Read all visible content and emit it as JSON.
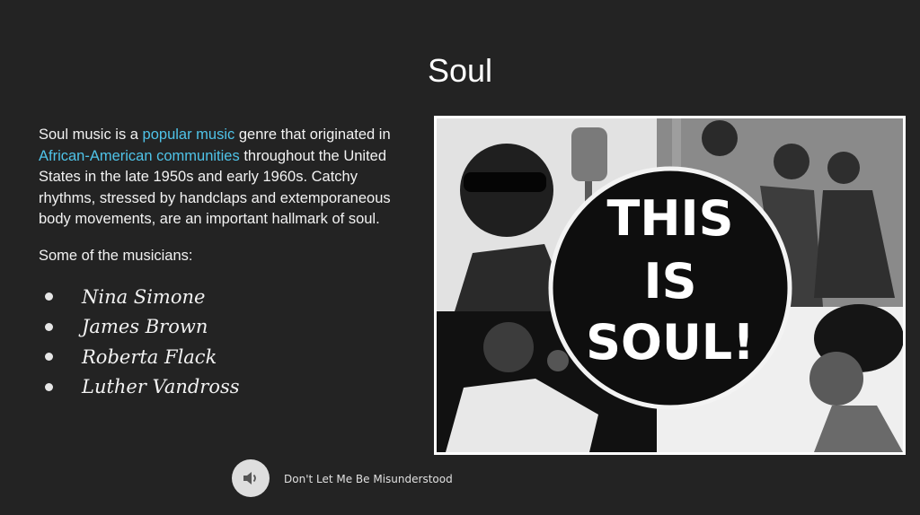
{
  "slide": {
    "title": "Soul",
    "intro": {
      "part1": "Soul music is a ",
      "link1": "popular music",
      "part2": " genre that originated in ",
      "link2": "African-American communities",
      "part3": " throughout the United States in the late 1950s and early 1960s. Catchy rhythms, stressed by handclaps and extemporaneous body movements, are an important hallmark of soul."
    },
    "subheading": "Some of the musicians:",
    "musicians": [
      "Nina Simone",
      "James Brown",
      "Roberta Flack",
      "Luther Vandross"
    ],
    "image": {
      "badge_lines": [
        "THIS",
        "IS",
        "SOUL!"
      ]
    }
  },
  "audio": {
    "icon": "speaker-icon",
    "track_title": "Don't Let Me Be Misunderstood"
  },
  "colors": {
    "background": "#232323",
    "text": "#ffffff",
    "link": "#4fc3e8",
    "button": "#dedede"
  }
}
